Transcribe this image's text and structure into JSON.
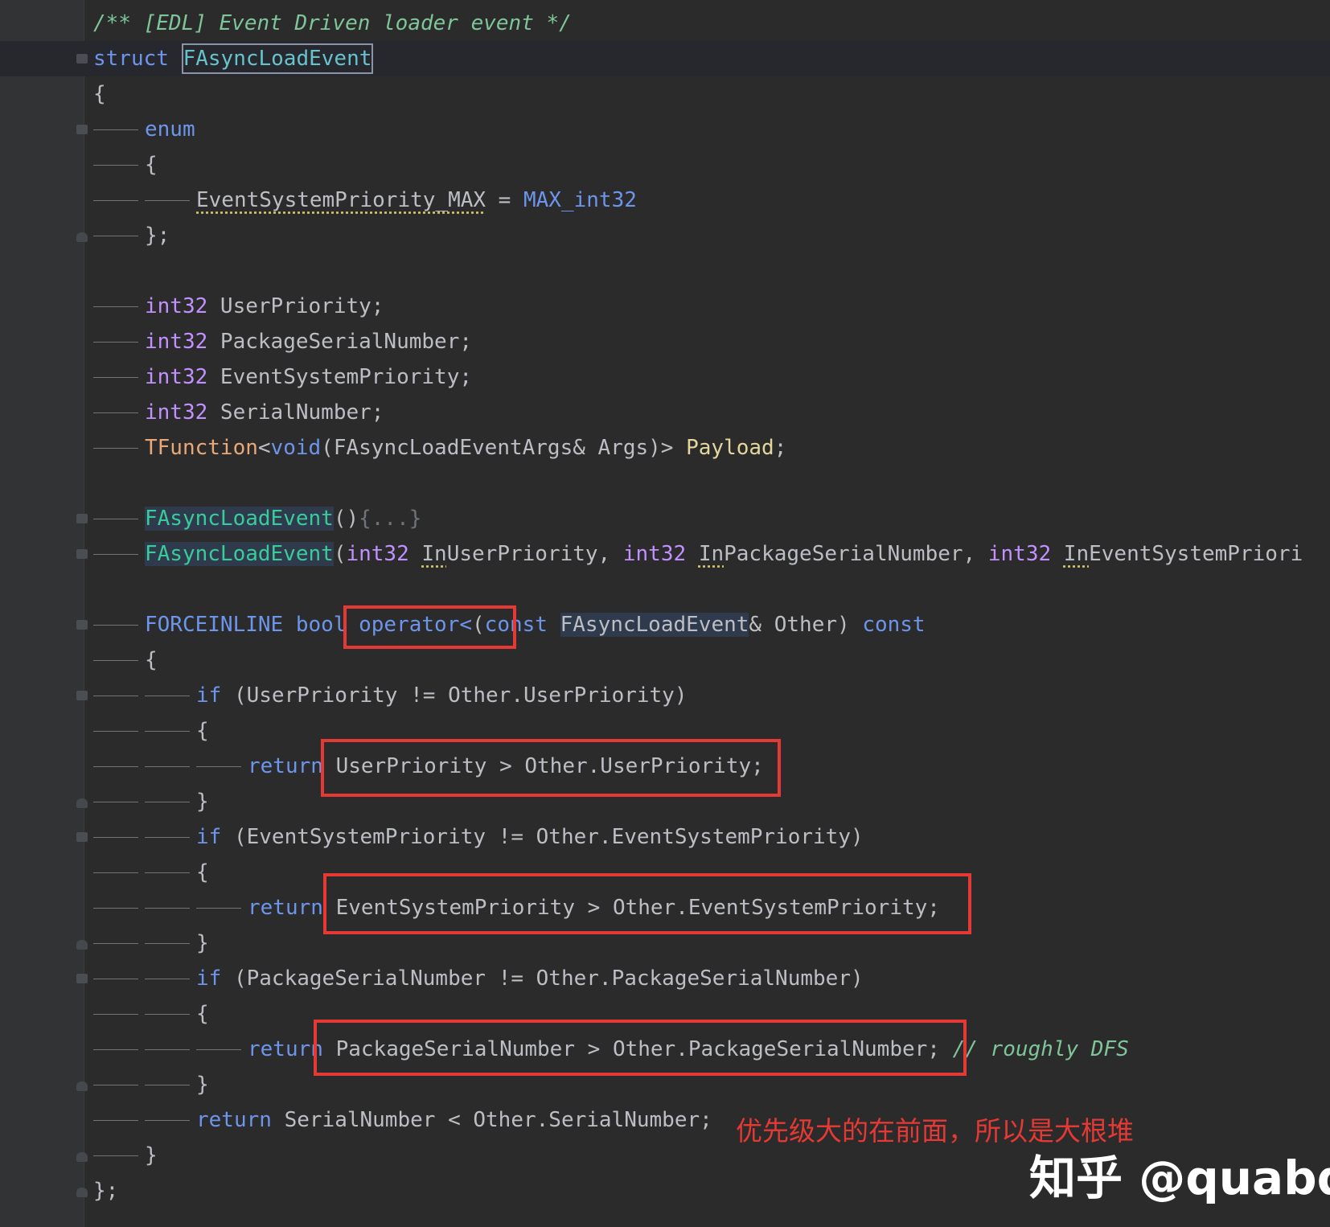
{
  "code_lines": [
    "/** [EDL] Event Driven loader event */",
    "struct FAsyncLoadEvent",
    "{",
    "enum",
    "{",
    "EventSystemPriority_MAX = MAX_int32",
    "};",
    "",
    "int32 UserPriority;",
    "int32 PackageSerialNumber;",
    "int32 EventSystemPriority;",
    "int32 SerialNumber;",
    "TFunction<void(FAsyncLoadEventArgs& Args)> Payload;",
    "",
    "FAsyncLoadEvent(){...}",
    "FAsyncLoadEvent(int32 InUserPriority, int32 InPackageSerialNumber, int32 InEventSystemPriori",
    "",
    "FORCEINLINE bool operator<(const FAsyncLoadEvent& Other) const",
    "{",
    "if (UserPriority != Other.UserPriority)",
    "{",
    "return UserPriority > Other.UserPriority;",
    "}",
    "if (EventSystemPriority != Other.EventSystemPriority)",
    "{",
    "return EventSystemPriority > Other.EventSystemPriority;",
    "}",
    "if (PackageSerialNumber != Other.PackageSerialNumber)",
    "{",
    "return PackageSerialNumber > Other.PackageSerialNumber;",
    "}",
    "return SerialNumber < Other.SerialNumber;",
    "}",
    "};"
  ],
  "inline_comment": "// roughly DFS",
  "annotation": "优先级大的在前面，所以是大根堆",
  "watermark": "知乎 @quabqi",
  "gutter_icon": "hammer-icon",
  "colors": {
    "background": "#2b2b2b",
    "keyword": "#6c95eb",
    "type": "#c191ff",
    "comment": "#7ec699",
    "function": "#39cc9b",
    "annotation_red": "#e53935"
  }
}
